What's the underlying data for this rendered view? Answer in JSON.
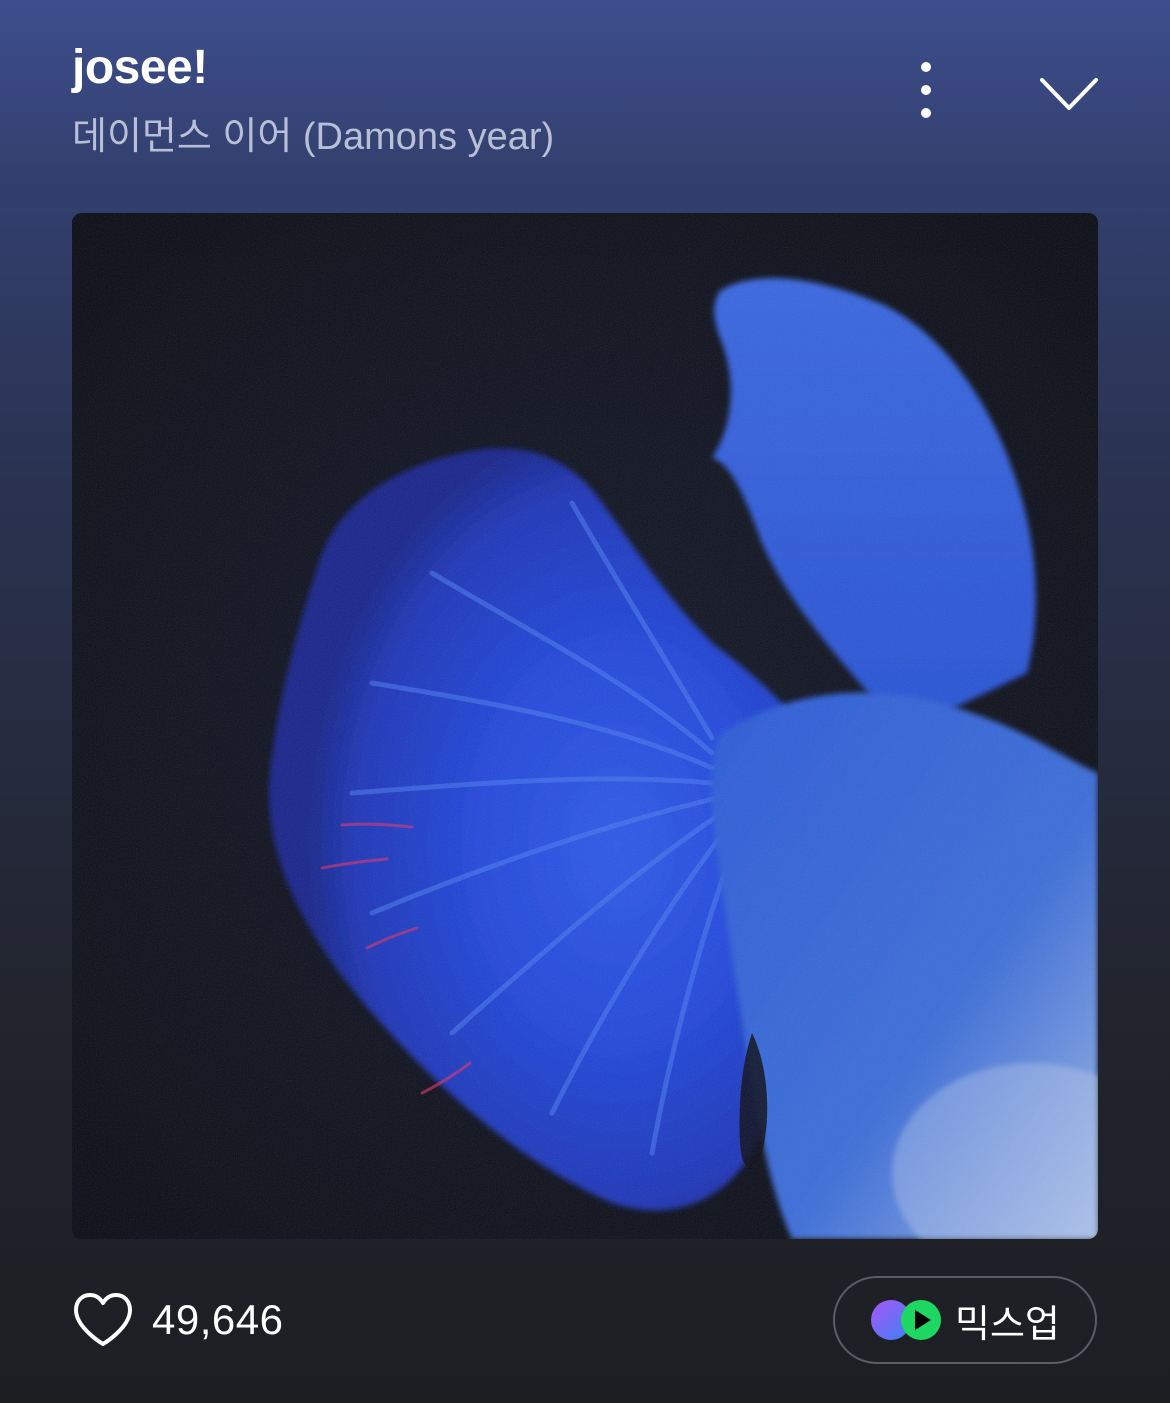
{
  "track": {
    "title": "josee!",
    "artist": "데이먼스 이어 (Damons year)"
  },
  "header": {
    "more_icon": "more-vertical-icon",
    "collapse_icon": "chevron-down-icon"
  },
  "album": {
    "art_description_icon": "album-cover-image"
  },
  "actions": {
    "like_icon": "heart-outline-icon",
    "like_count": "49,646",
    "mixup_label": "믹스업",
    "mixup_icon": "mixup-logo-icon"
  },
  "colors": {
    "accent_green": "#1ed760",
    "accent_purple": "#8a5cf6",
    "accent_blue": "#3b82f6"
  }
}
